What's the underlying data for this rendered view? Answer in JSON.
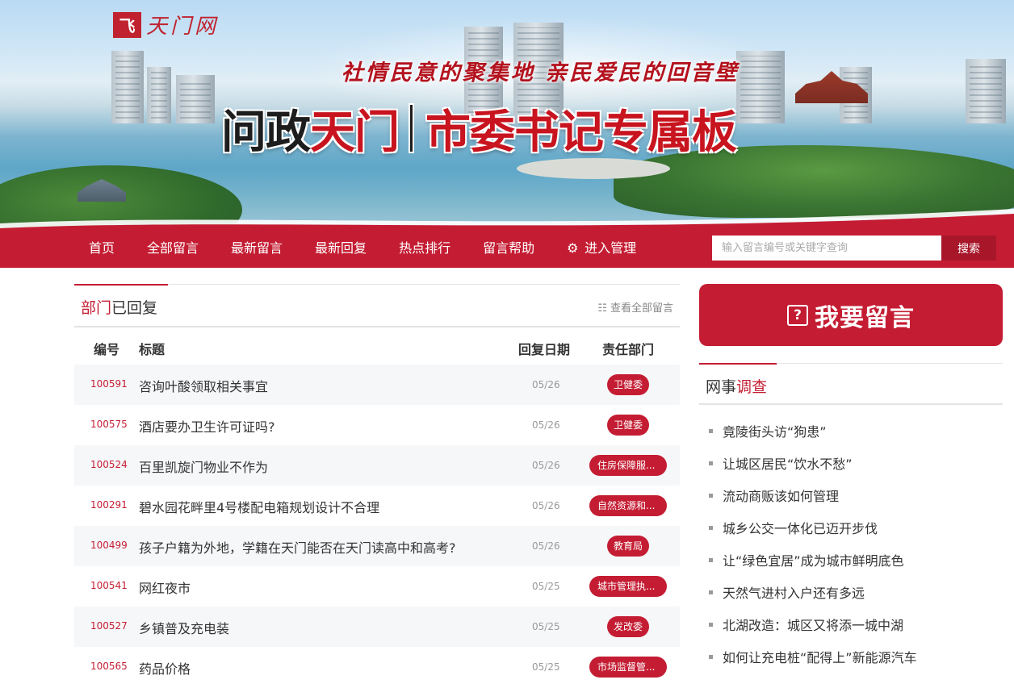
{
  "banner": {
    "logo_mark": "飞",
    "logo_text": "天门网",
    "slogan": "社情民意的聚集地 亲民爱民的回音壁",
    "headline_part1": "问政",
    "headline_part2": "天门",
    "headline_part3": "市委书记专属板"
  },
  "nav": {
    "items": [
      "首页",
      "全部留言",
      "最新留言",
      "最新回复",
      "热点排行",
      "留言帮助"
    ],
    "admin_label": "进入管理",
    "search_placeholder": "输入留言编号或关键字查询",
    "search_button": "搜索"
  },
  "replied": {
    "title_red": "部门",
    "title_rest": "已回复",
    "view_all": "查看全部留言",
    "columns": {
      "id": "编号",
      "title": "标题",
      "date": "回复日期",
      "dept": "责任部门"
    },
    "rows": [
      {
        "id": "100591",
        "title": "咨询叶酸领取相关事宜",
        "date": "05/26",
        "dept": "卫健委"
      },
      {
        "id": "100575",
        "title": "酒店要办卫生许可证吗?",
        "date": "05/26",
        "dept": "卫健委"
      },
      {
        "id": "100524",
        "title": "百里凯旋门物业不作为",
        "date": "05/26",
        "dept": "住房保障服..."
      },
      {
        "id": "100291",
        "title": "碧水园花畔里4号楼配电箱规划设计不合理",
        "date": "05/26",
        "dept": "自然资源和..."
      },
      {
        "id": "100499",
        "title": "孩子户籍为外地，学籍在天门能否在天门读高中和高考?",
        "date": "05/26",
        "dept": "教育局"
      },
      {
        "id": "100541",
        "title": "网红夜市",
        "date": "05/25",
        "dept": "城市管理执..."
      },
      {
        "id": "100527",
        "title": "乡镇普及充电装",
        "date": "05/25",
        "dept": "发改委"
      },
      {
        "id": "100565",
        "title": "药品价格",
        "date": "05/25",
        "dept": "市场监督管..."
      }
    ]
  },
  "cta": {
    "icon": "?",
    "label": "我要留言"
  },
  "survey": {
    "title_rest": "网事",
    "title_red": "调查",
    "items": [
      "竟陵街头访“狗患”",
      "让城区居民“饮水不愁”",
      "流动商贩该如何管理",
      "城乡公交一体化已迈开步伐",
      "让“绿色宜居”成为城市鲜明底色",
      "天然气进村入户还有多远",
      "北湖改造：城区又将添一城中湖",
      "如何让充电桩“配得上”新能源汽车"
    ]
  },
  "colors": {
    "brand_red": "#c41d33",
    "dark_red": "#a8162a"
  }
}
